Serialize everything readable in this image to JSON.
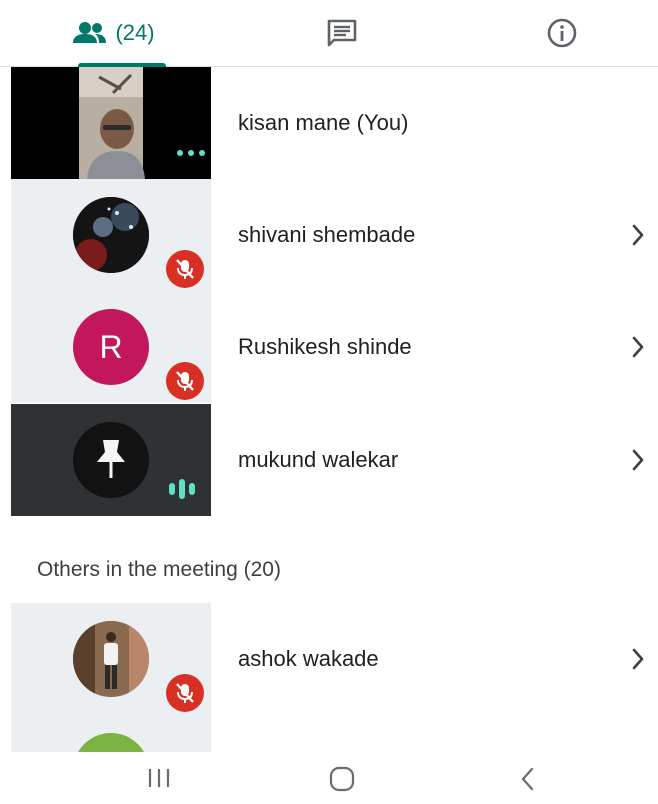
{
  "tabs": {
    "people": {
      "icon": "people-icon",
      "label": "(24)"
    },
    "chat": {
      "icon": "chat-icon"
    },
    "info": {
      "icon": "info-icon"
    }
  },
  "colors": {
    "accent": "#00796b",
    "mute_red": "#d93025",
    "speaking_green": "#5fe0c3",
    "avatar_r": "#c2185b"
  },
  "participants": [
    {
      "name": "kisan mane (You)",
      "status": "video-on"
    },
    {
      "name": "shivani shembade",
      "status": "muted"
    },
    {
      "name": "Rushikesh shinde",
      "initial": "R",
      "status": "muted"
    },
    {
      "name": "mukund walekar",
      "status": "speaking"
    }
  ],
  "others_section": {
    "title": "Others in the meeting (20)",
    "participants": [
      {
        "name": "ashok wakade",
        "status": "muted"
      }
    ]
  },
  "navbar": {
    "buttons": [
      "recent-apps-icon",
      "home-icon",
      "back-icon"
    ]
  }
}
